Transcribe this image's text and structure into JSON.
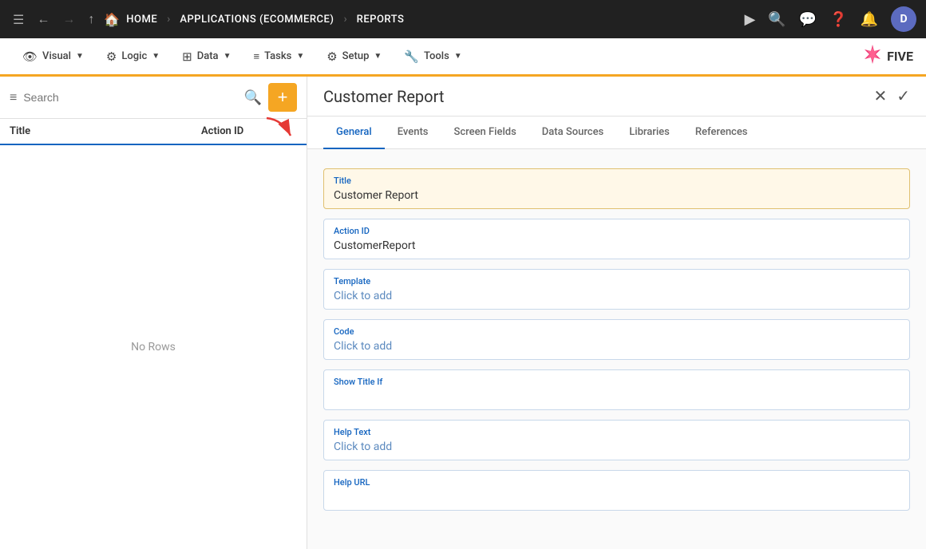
{
  "topNav": {
    "menuIcon": "☰",
    "backIcon": "←",
    "upIcon": "↑",
    "homeLabel": "HOME",
    "appsLabel": "APPLICATIONS (ECOMMERCE)",
    "reportsLabel": "REPORTS",
    "playIcon": "▶",
    "searchIcon": "🔍",
    "chatIcon": "💬",
    "helpIcon": "❓",
    "bellIcon": "🔔",
    "avatarLabel": "D"
  },
  "secondNav": {
    "items": [
      {
        "id": "visual",
        "icon": "👁",
        "label": "Visual",
        "hasDropdown": true
      },
      {
        "id": "logic",
        "icon": "⚙",
        "label": "Logic",
        "hasDropdown": true
      },
      {
        "id": "data",
        "icon": "⊞",
        "label": "Data",
        "hasDropdown": true
      },
      {
        "id": "tasks",
        "icon": "☰",
        "label": "Tasks",
        "hasDropdown": true
      },
      {
        "id": "setup",
        "icon": "⚙",
        "label": "Setup",
        "hasDropdown": true
      },
      {
        "id": "tools",
        "icon": "🔧",
        "label": "Tools",
        "hasDropdown": true
      }
    ],
    "logoStar": "✦",
    "logoText": "FIVE"
  },
  "leftPanel": {
    "searchPlaceholder": "Search",
    "addBtnLabel": "+",
    "columns": [
      {
        "id": "title",
        "label": "Title"
      },
      {
        "id": "actionId",
        "label": "Action ID"
      }
    ],
    "emptyMessage": "No Rows"
  },
  "rightPanel": {
    "title": "Customer Report",
    "tabs": [
      {
        "id": "general",
        "label": "General",
        "active": true
      },
      {
        "id": "events",
        "label": "Events"
      },
      {
        "id": "screenFields",
        "label": "Screen Fields"
      },
      {
        "id": "dataSources",
        "label": "Data Sources"
      },
      {
        "id": "libraries",
        "label": "Libraries"
      },
      {
        "id": "references",
        "label": "References"
      }
    ],
    "fields": [
      {
        "id": "title",
        "label": "Title",
        "value": "Customer Report",
        "placeholder": false,
        "highlighted": true
      },
      {
        "id": "actionId",
        "label": "Action ID",
        "value": "CustomerReport",
        "placeholder": false,
        "highlighted": false
      },
      {
        "id": "template",
        "label": "Template",
        "value": "Click to add",
        "placeholder": true,
        "highlighted": false
      },
      {
        "id": "code",
        "label": "Code",
        "value": "Click to add",
        "placeholder": true,
        "highlighted": false
      },
      {
        "id": "showTitleIf",
        "label": "Show Title If",
        "value": "",
        "placeholder": false,
        "highlighted": false
      },
      {
        "id": "helpText",
        "label": "Help Text",
        "value": "Click to add",
        "placeholder": true,
        "highlighted": false
      },
      {
        "id": "helpUrl",
        "label": "Help URL",
        "value": "",
        "placeholder": false,
        "highlighted": false
      }
    ]
  }
}
